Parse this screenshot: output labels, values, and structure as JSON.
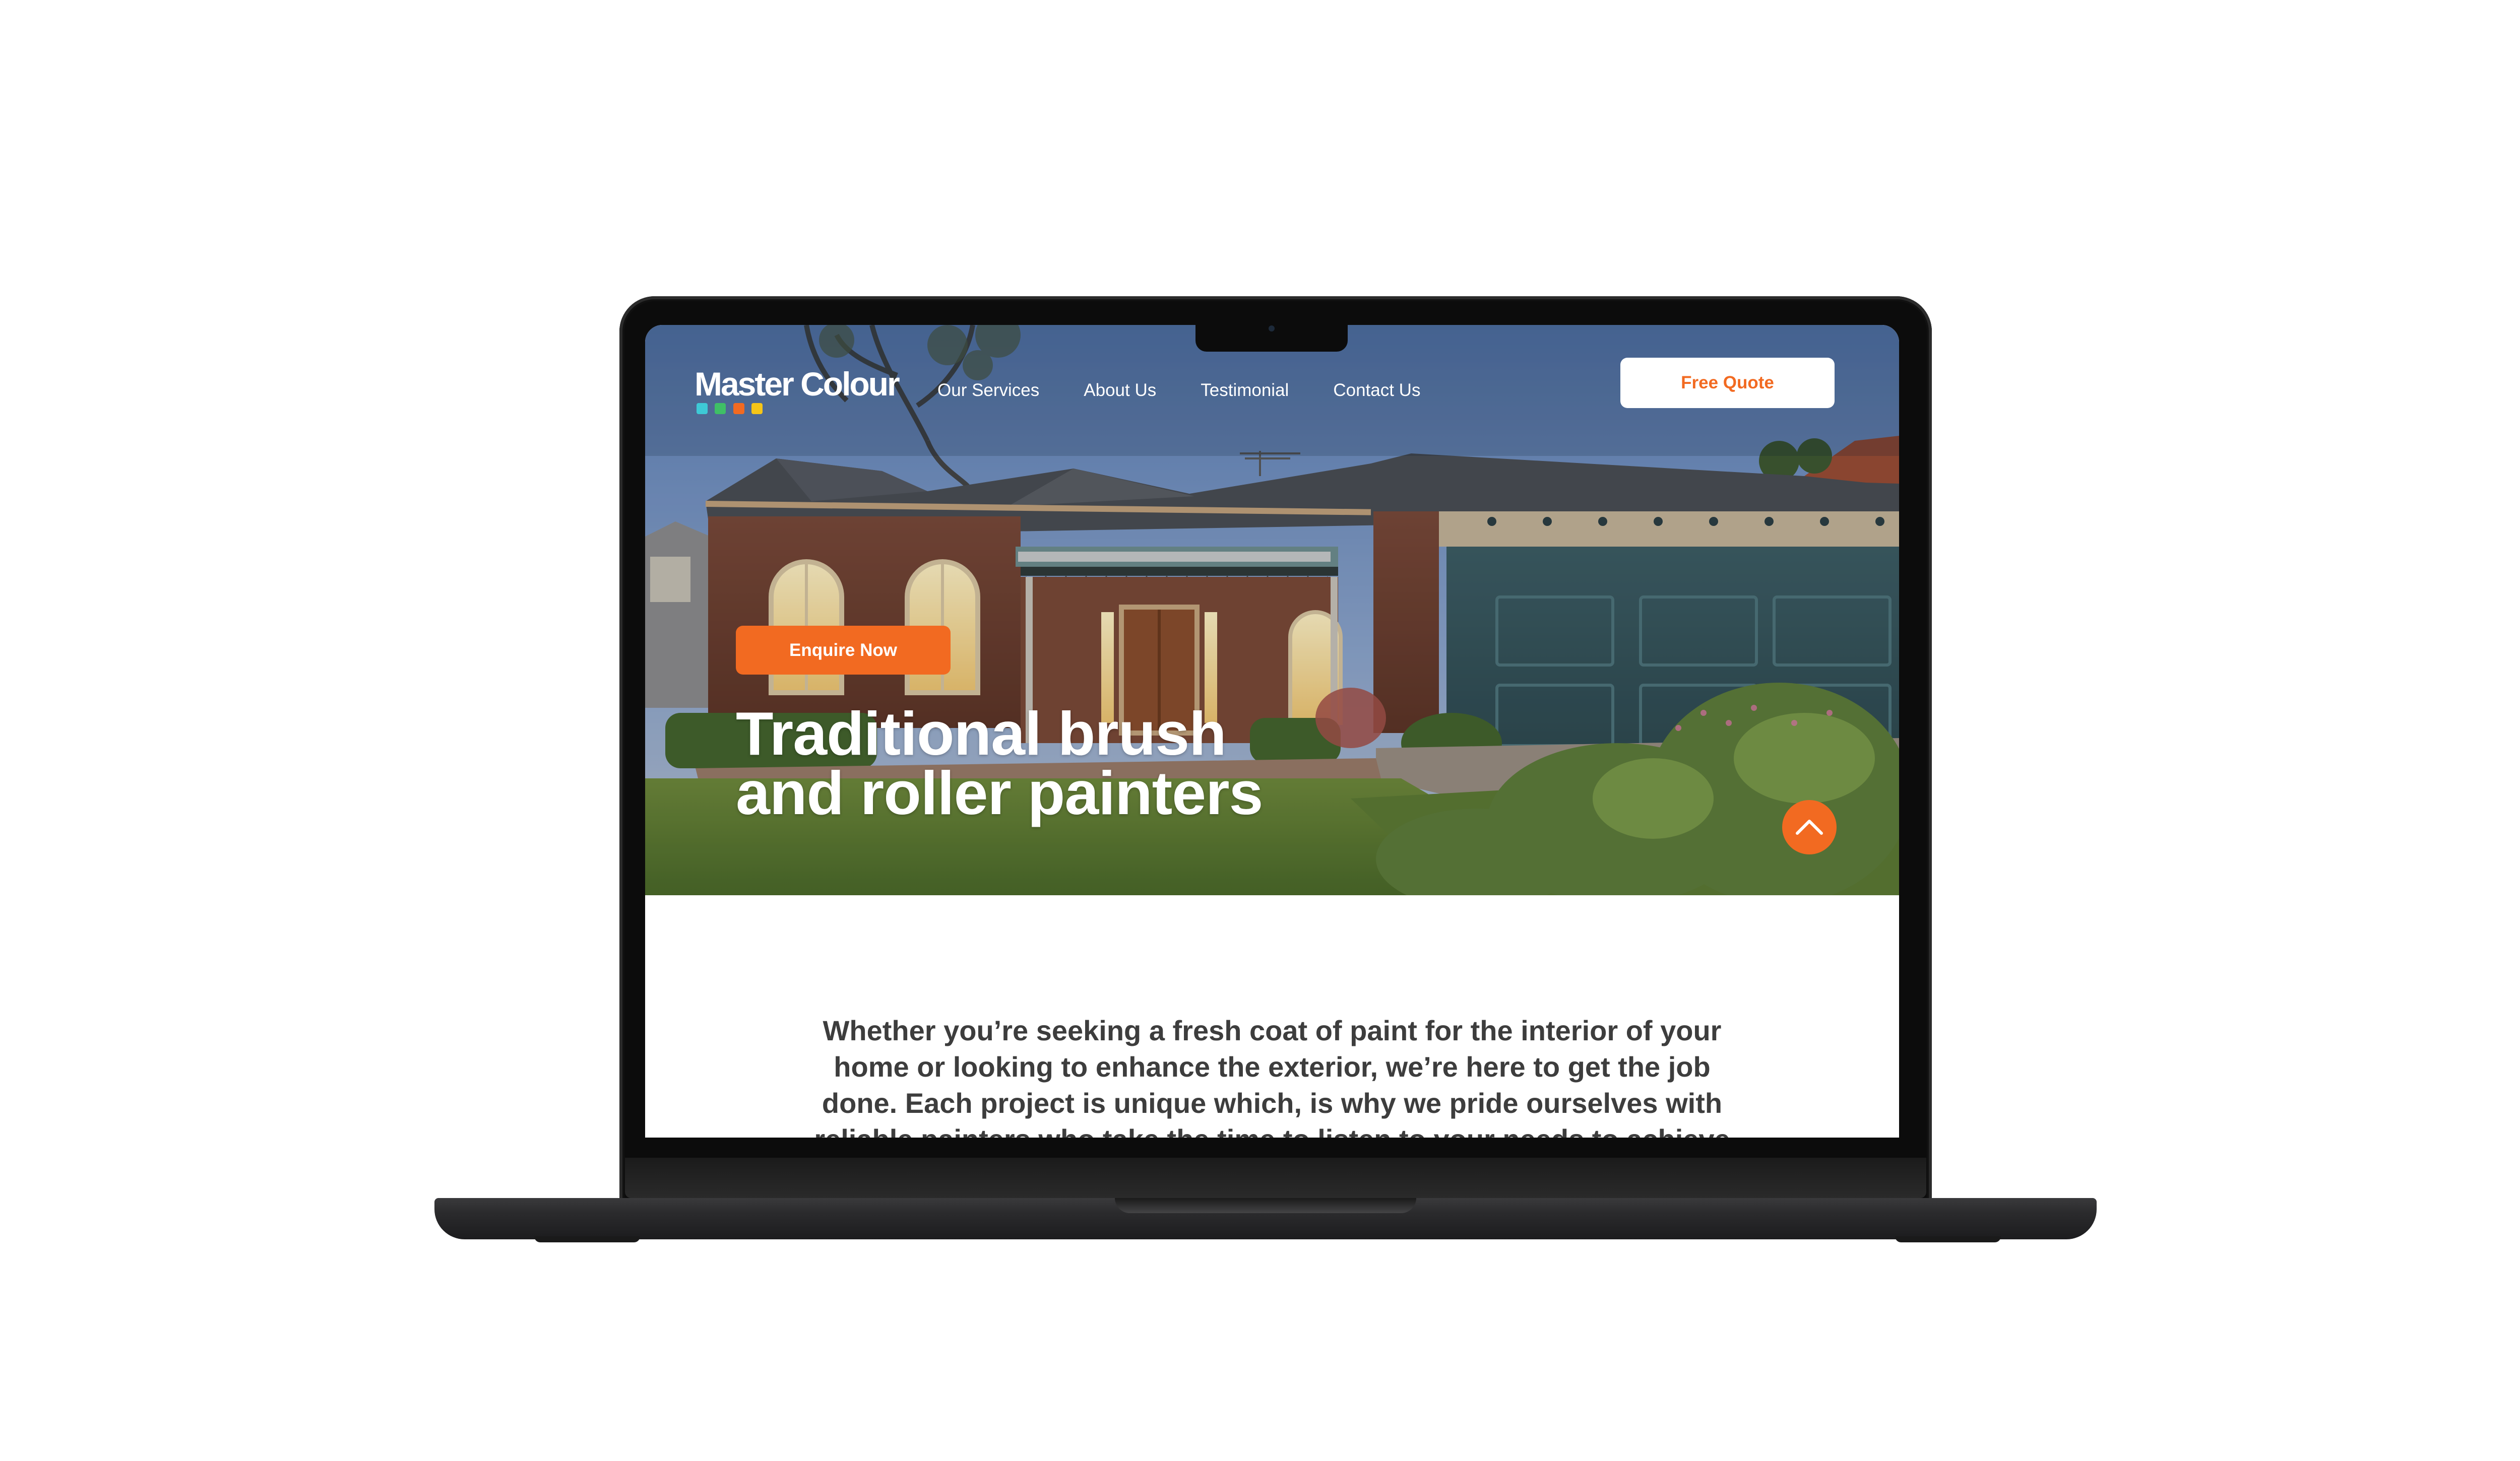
{
  "brand": {
    "name": "Master Colour",
    "dot_colors": [
      "#3ec9d6",
      "#3fbf66",
      "#f26a21",
      "#f5c518"
    ]
  },
  "nav": {
    "items": [
      "Our Services",
      "About Us",
      "Testimonial",
      "Contact Us"
    ],
    "cta_label": "Free Quote"
  },
  "hero": {
    "enquire_label": "Enquire Now",
    "headline_line1": "Traditional brush",
    "headline_line2": "and roller painters",
    "scroll_icon": "chevron-up-icon"
  },
  "intro": {
    "text": "Whether you’re seeking a fresh coat of paint for the interior of your home or looking to enhance the exterior, we’re here to get the job done. Each project is unique which, is why we pride ourselves with reliable painters who take the time to listen to your needs to achieve"
  },
  "colors": {
    "accent": "#f26a21",
    "nav_text": "#ffffff",
    "body_text": "#3d3d3d"
  }
}
